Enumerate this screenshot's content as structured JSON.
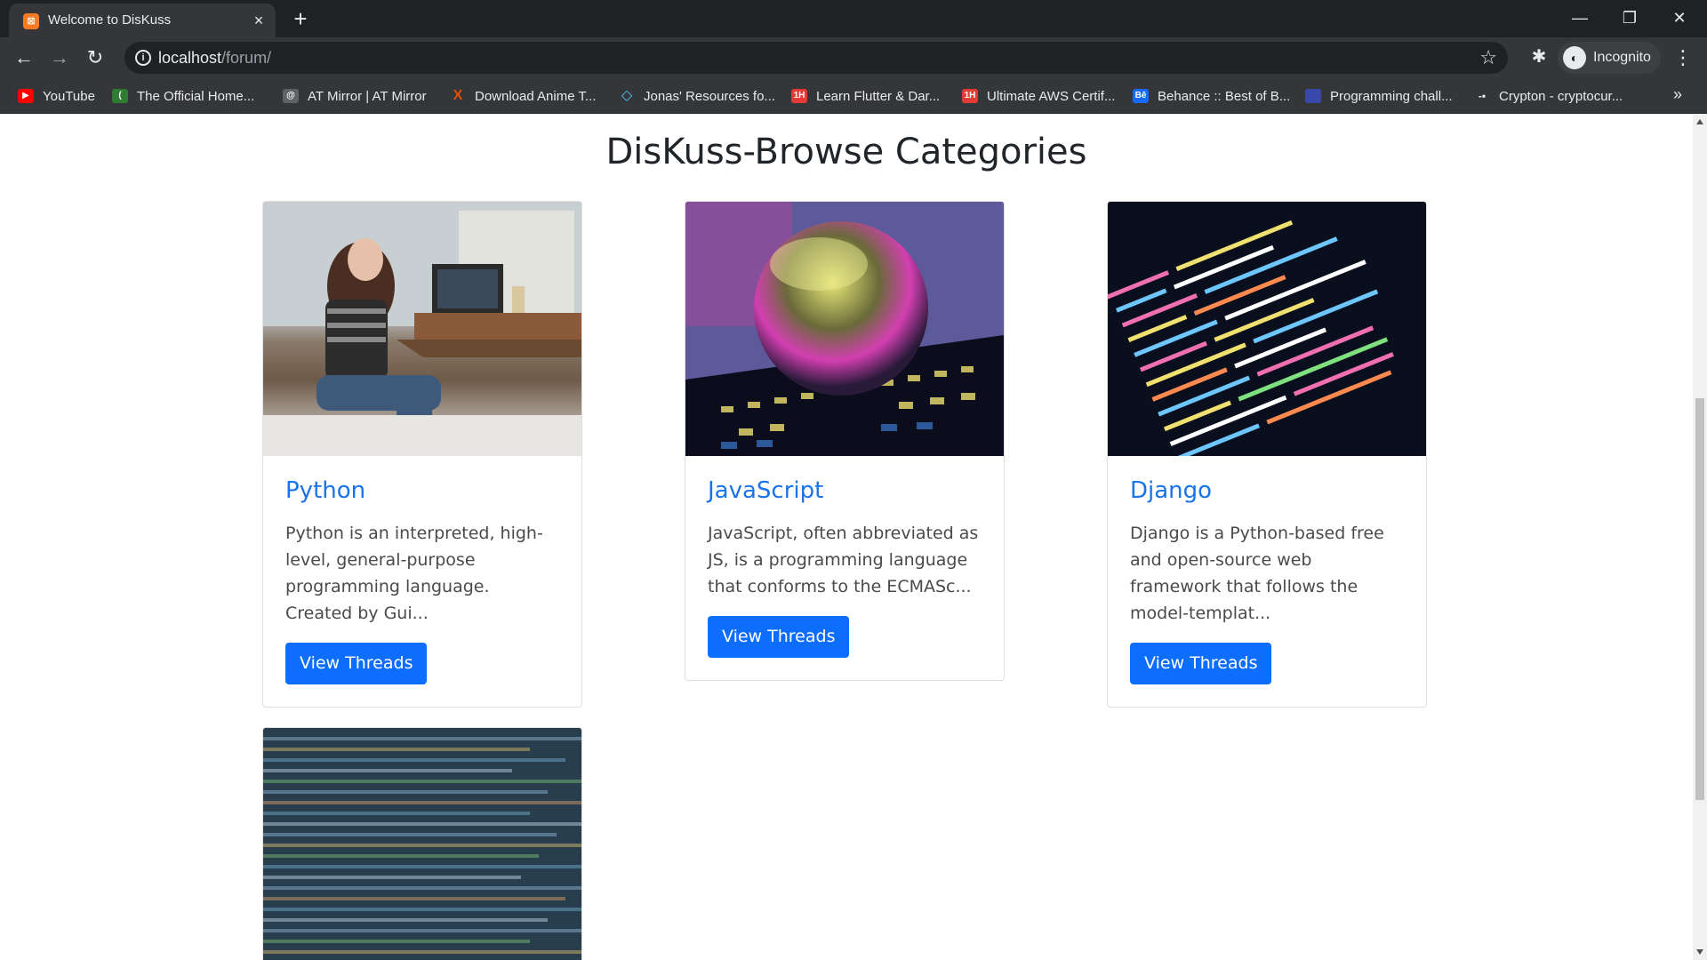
{
  "browser": {
    "tab_title": "Welcome to DisKuss",
    "url_host": "localhost",
    "url_path": "/forum/",
    "profile_label": "Incognito",
    "bookmarks": [
      {
        "label": "YouTube",
        "icon": "youtube-icon",
        "color": "#ff0000"
      },
      {
        "label": "The Official Home...",
        "icon": "site-icon",
        "color": "#2e7d32"
      },
      {
        "label": "AT Mirror | AT Mirror",
        "icon": "at-mirror-icon",
        "color": "#5f6368"
      },
      {
        "label": "Download Anime T...",
        "icon": "x-icon",
        "color": "#e65100"
      },
      {
        "label": "Jonas' Resources fo...",
        "icon": "diamond-icon",
        "color": "#4fc3f7"
      },
      {
        "label": "Learn Flutter & Dar...",
        "icon": "1h-icon",
        "color": "#e53935"
      },
      {
        "label": "Ultimate AWS Certif...",
        "icon": "1h-icon",
        "color": "#e53935"
      },
      {
        "label": "Behance :: Best of B...",
        "icon": "behance-icon",
        "color": "#1769ff"
      },
      {
        "label": "Programming chall...",
        "icon": "challenge-icon",
        "color": "#3949ab"
      },
      {
        "label": "Crypton - cryptocur...",
        "icon": "crypton-icon",
        "color": "#5f6368"
      }
    ]
  },
  "page": {
    "heading": "DisKuss-Browse Categories",
    "categories": [
      {
        "title": "Python",
        "description": "Python is an interpreted, high-level, general-purpose programming language. Created by Gui...",
        "button_label": "View Threads",
        "image": "woman-with-laptop-photo"
      },
      {
        "title": "JavaScript",
        "description": "JavaScript, often abbreviated as JS, is a programming language that conforms to the ECMASc...",
        "button_label": "View Threads",
        "image": "crystal-ball-photo"
      },
      {
        "title": "Django",
        "description": "Django is a Python-based free and open-source web framework that follows the model-templat...",
        "button_label": "View Threads",
        "image": "code-screen-photo"
      },
      {
        "title": "",
        "description": "",
        "button_label": "",
        "image": "blurred-code-photo"
      }
    ]
  },
  "colors": {
    "link": "#1a73e8",
    "button": "#0d6efd",
    "heading": "#212529"
  }
}
